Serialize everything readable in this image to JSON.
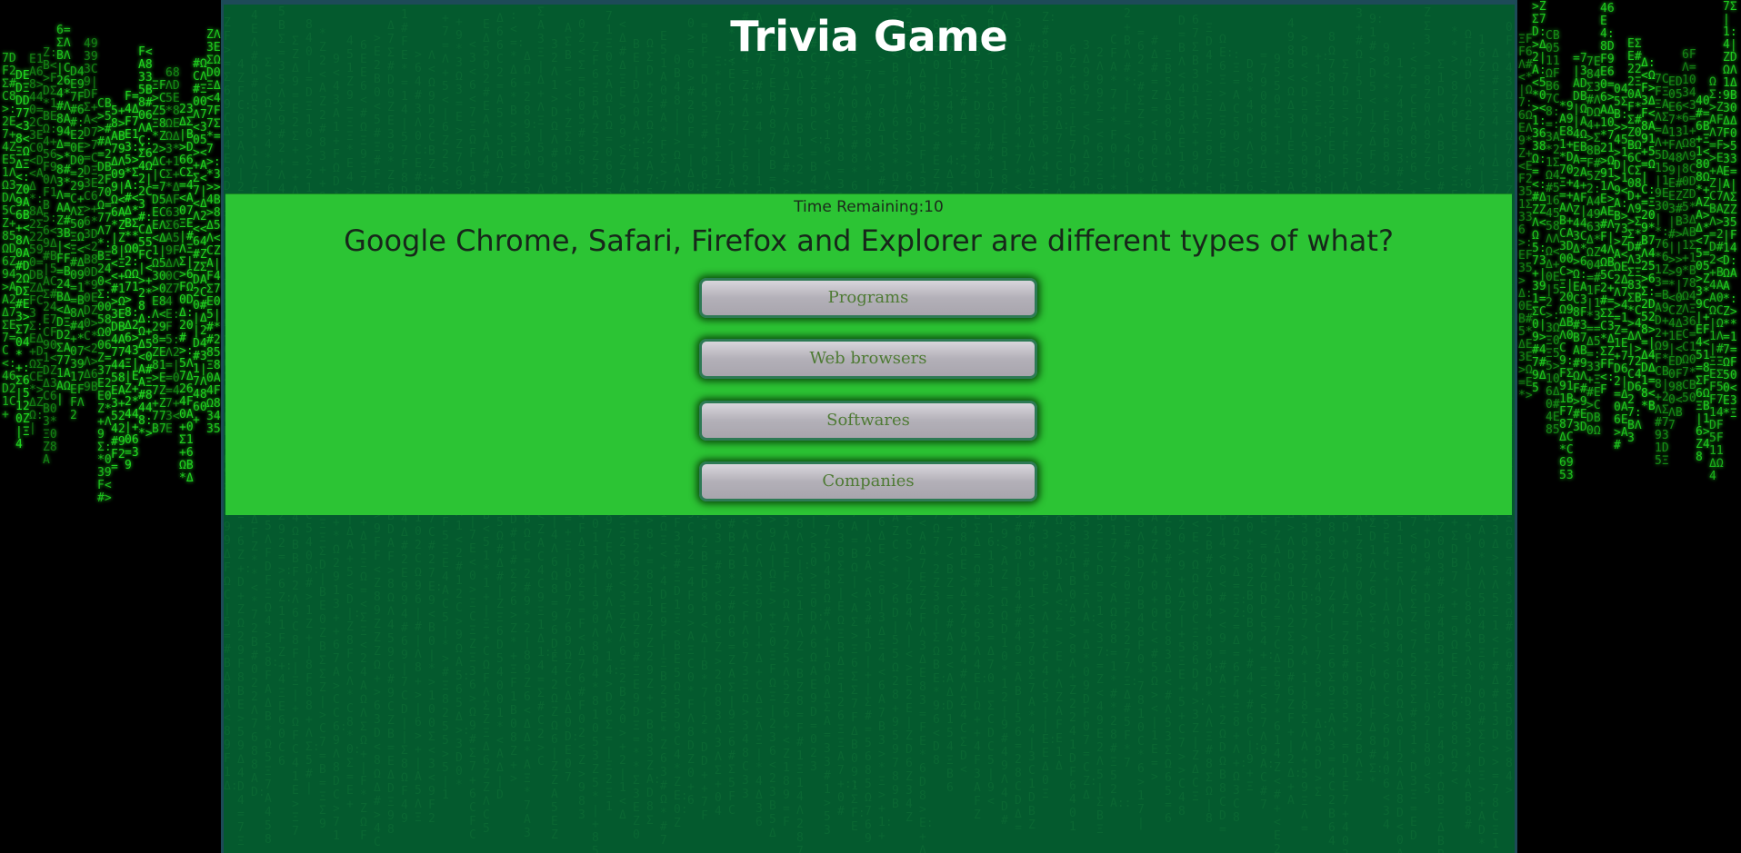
{
  "title": "Trivia Game",
  "timer": "Time Remaining:10",
  "question": "Google Chrome, Safari, Firefox and Explorer are different types of what?",
  "answers": [
    {
      "label": "Programs"
    },
    {
      "label": "Web browsers"
    },
    {
      "label": "Softwares"
    },
    {
      "label": "Companies"
    }
  ],
  "colors": {
    "panel": "#045a2e",
    "band": "#2cc434",
    "rain": "#22e022",
    "answer_text": "#4e7a34"
  }
}
